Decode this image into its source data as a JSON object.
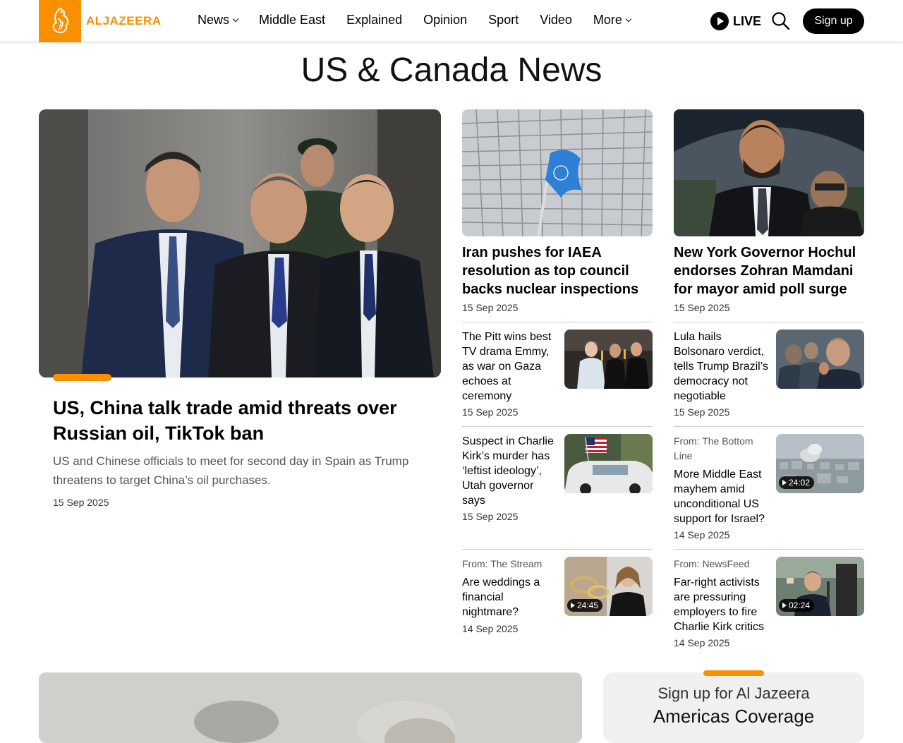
{
  "brand": {
    "name": "ALJAZEERA",
    "accent": "#fa9000"
  },
  "nav": [
    "News",
    "Middle East",
    "Explained",
    "Opinion",
    "Sport",
    "Video",
    "More"
  ],
  "header": {
    "live_label": "LIVE",
    "signup_label": "Sign up"
  },
  "page_title": "US & Canada News",
  "lead": {
    "title": "US, China talk trade amid threats over Russian oil, TikTok ban",
    "summary": "US and Chinese officials to meet for second day in Spain as Trump threatens to target China’s oil purchases.",
    "date": "15 Sep 2025"
  },
  "featured": [
    {
      "title": "Iran pushes for IAEA resolution as top council backs nuclear inspections",
      "date": "15 Sep 2025"
    },
    {
      "title": "New York Governor Hochul endorses Zohran Mamdani for mayor amid poll surge",
      "date": "15 Sep 2025"
    }
  ],
  "items": [
    {
      "title": "The Pitt wins best TV drama Emmy, as war on Gaza echoes at ceremony",
      "date": "15 Sep 2025"
    },
    {
      "title": "Lula hails Bolsonaro verdict, tells Trump Brazil’s democracy not negotiable",
      "date": "15 Sep 2025"
    },
    {
      "title": "Suspect in Charlie Kirk’s murder has ‘leftist ideology’, Utah governor says",
      "date": "15 Sep 2025"
    },
    {
      "from": "From: The Bottom Line",
      "title": "More Middle East mayhem amid unconditional US support for Israel?",
      "date": "14 Sep 2025",
      "duration": "24:02"
    },
    {
      "from": "From: The Stream",
      "title": "Are weddings a financial nightmare?",
      "date": "14 Sep 2025",
      "duration": "24:45"
    },
    {
      "from": "From: NewsFeed",
      "title": "Far-right activists are pressuring employers to fire Charlie Kirk critics",
      "date": "14 Sep 2025",
      "duration": "02:24"
    }
  ],
  "promo": {
    "line1": "Sign up for Al Jazeera",
    "line2": "Americas Coverage"
  }
}
